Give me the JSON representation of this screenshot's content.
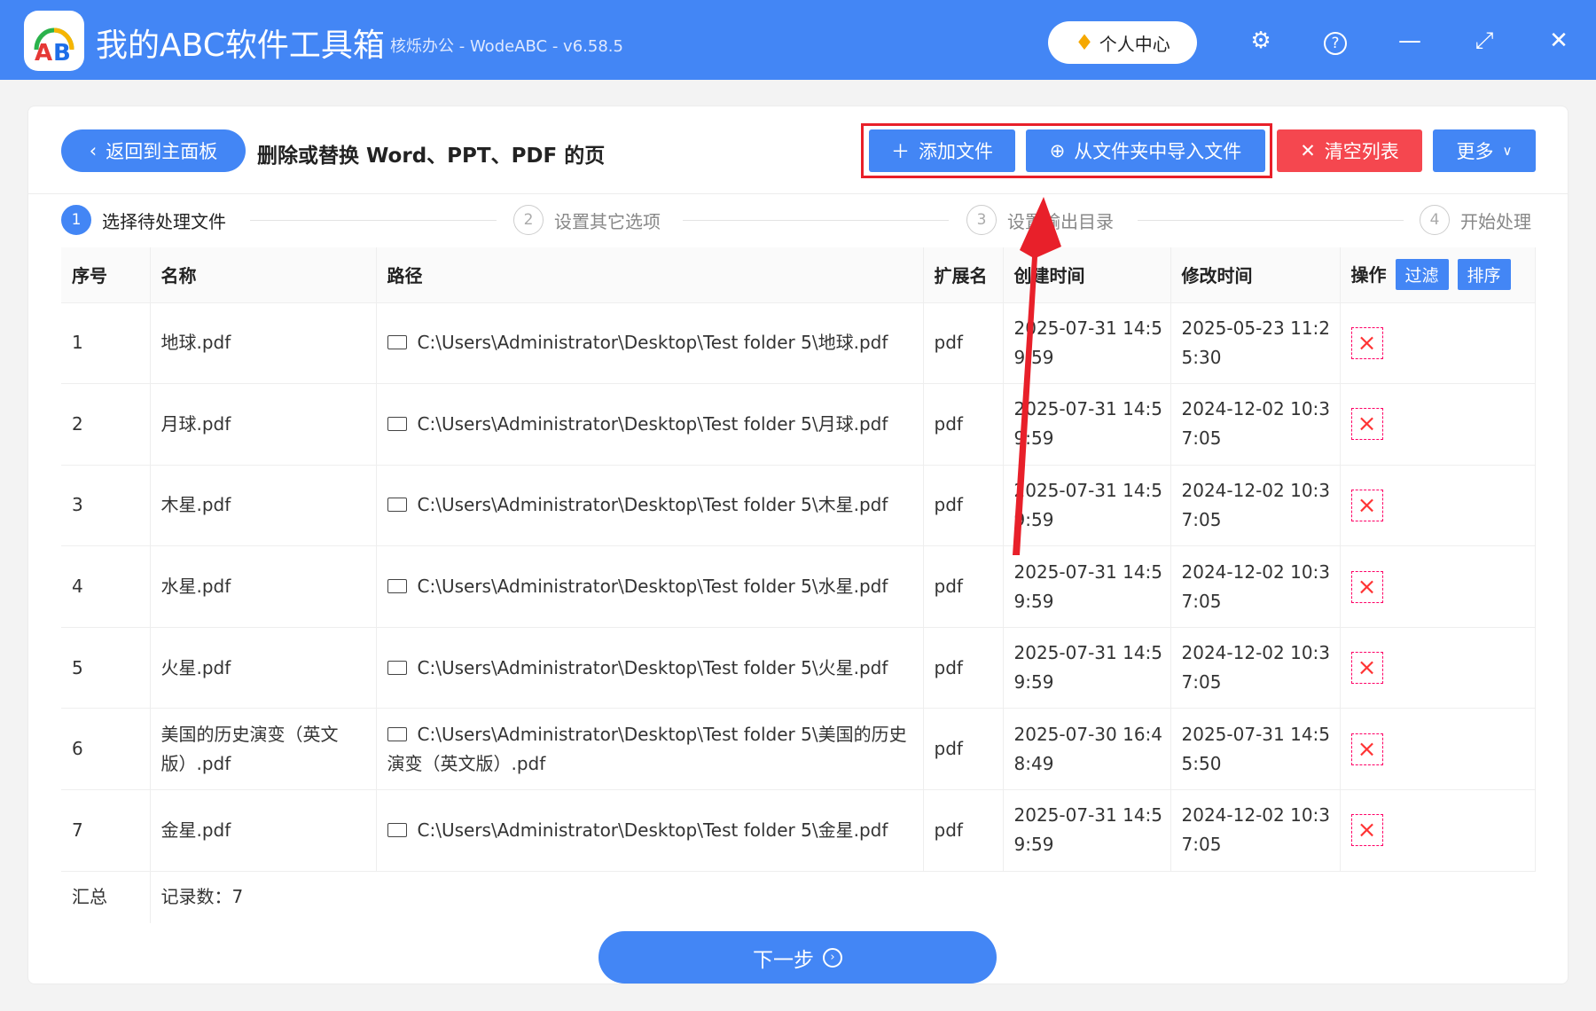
{
  "app": {
    "title": "我的ABC软件工具箱",
    "subtitle": "核烁办公 - WodeABC - v6.58.5",
    "user_center": "个人中心"
  },
  "toolbar": {
    "back": "返回到主面板",
    "page_title": "删除或替换 Word、PPT、PDF 的页",
    "add_file": "添加文件",
    "import_folder": "从文件夹中导入文件",
    "clear_list": "清空列表",
    "more": "更多"
  },
  "steps": [
    {
      "num": "1",
      "label": "选择待处理文件"
    },
    {
      "num": "2",
      "label": "设置其它选项"
    },
    {
      "num": "3",
      "label": "设置输出目录"
    },
    {
      "num": "4",
      "label": "开始处理"
    }
  ],
  "table": {
    "headers": [
      "序号",
      "名称",
      "路径",
      "扩展名",
      "创建时间",
      "修改时间",
      "操作"
    ],
    "filter": "过滤",
    "sort": "排序",
    "rows": [
      {
        "idx": "1",
        "name": "地球.pdf",
        "path": "C:\\Users\\Administrator\\Desktop\\Test folder 5\\地球.pdf",
        "ext": "pdf",
        "created": "2025-07-31 14:59:59",
        "modified": "2025-05-23 11:25:30"
      },
      {
        "idx": "2",
        "name": "月球.pdf",
        "path": "C:\\Users\\Administrator\\Desktop\\Test folder 5\\月球.pdf",
        "ext": "pdf",
        "created": "2025-07-31 14:59:59",
        "modified": "2024-12-02 10:37:05"
      },
      {
        "idx": "3",
        "name": "木星.pdf",
        "path": "C:\\Users\\Administrator\\Desktop\\Test folder 5\\木星.pdf",
        "ext": "pdf",
        "created": "2025-07-31 14:59:59",
        "modified": "2024-12-02 10:37:05"
      },
      {
        "idx": "4",
        "name": "水星.pdf",
        "path": "C:\\Users\\Administrator\\Desktop\\Test folder 5\\水星.pdf",
        "ext": "pdf",
        "created": "2025-07-31 14:59:59",
        "modified": "2024-12-02 10:37:05"
      },
      {
        "idx": "5",
        "name": "火星.pdf",
        "path": "C:\\Users\\Administrator\\Desktop\\Test folder 5\\火星.pdf",
        "ext": "pdf",
        "created": "2025-07-31 14:59:59",
        "modified": "2024-12-02 10:37:05"
      },
      {
        "idx": "6",
        "name": "美国的历史演变（英文版）.pdf",
        "path": "C:\\Users\\Administrator\\Desktop\\Test folder 5\\美国的历史演变（英文版）.pdf",
        "ext": "pdf",
        "created": "2025-07-30 16:48:49",
        "modified": "2025-07-31 14:55:50"
      },
      {
        "idx": "7",
        "name": "金星.pdf",
        "path": "C:\\Users\\Administrator\\Desktop\\Test folder 5\\金星.pdf",
        "ext": "pdf",
        "created": "2025-07-31 14:59:59",
        "modified": "2024-12-02 10:37:05"
      }
    ],
    "summary_label": "汇总",
    "summary_value": "记录数：7"
  },
  "next": "下一步"
}
